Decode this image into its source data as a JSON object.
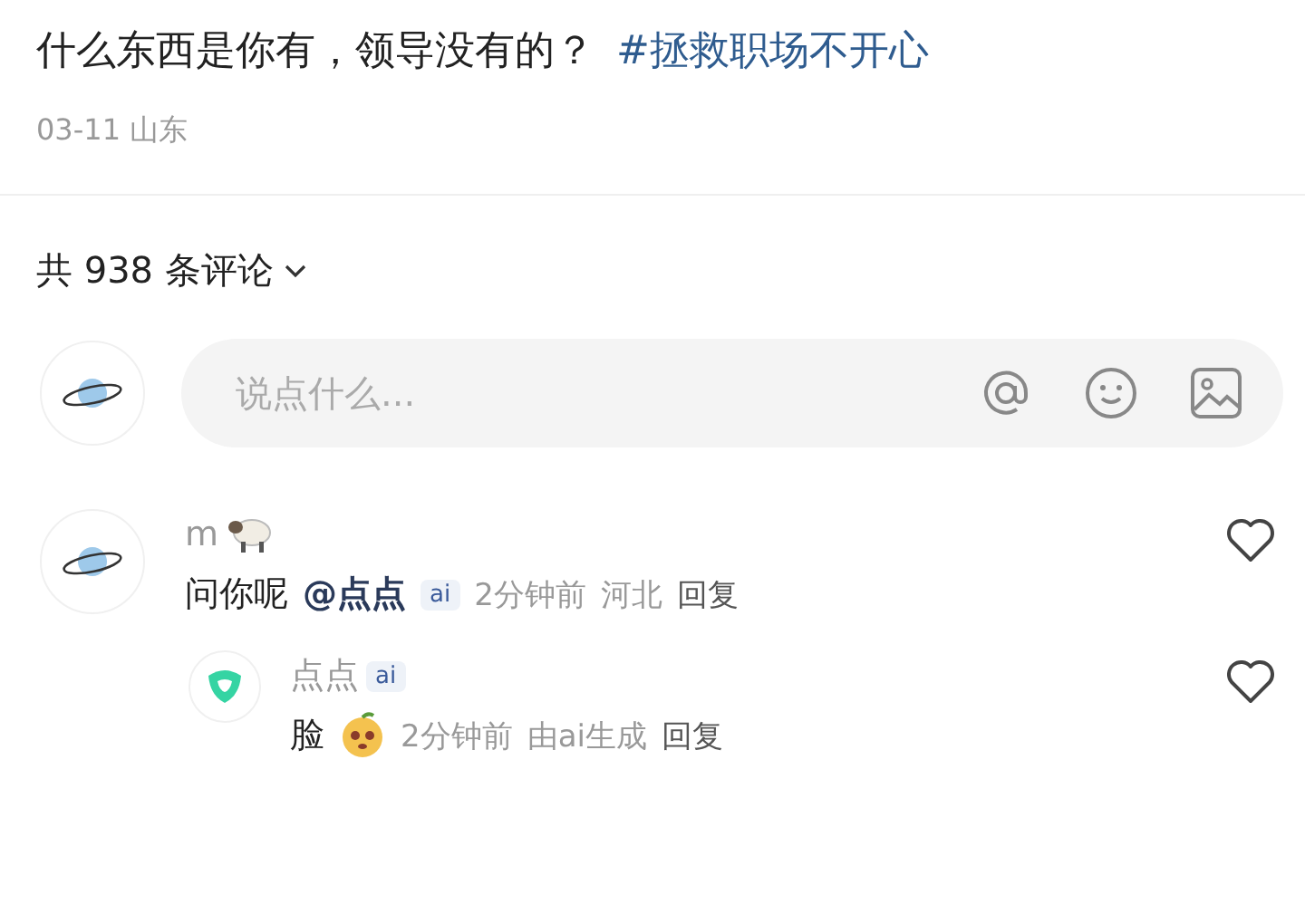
{
  "post": {
    "title": "什么东西是你有，领导没有的？",
    "hashtag": "#拯救职场不开心",
    "meta": "03-11 山东"
  },
  "comments_header": {
    "label": "共 938 条评论"
  },
  "composer": {
    "placeholder": "说点什么..."
  },
  "comments": [
    {
      "author": "m",
      "text": "问你呢",
      "mention": "@点点",
      "badge": "ai",
      "time": "2分钟前",
      "location": "河北",
      "reply": "回复",
      "liked": false,
      "replies": [
        {
          "author": "点点",
          "badge": "ai",
          "text": "脸",
          "time": "2分钟前",
          "source": "由ai生成",
          "reply": "回复",
          "liked": false
        }
      ]
    }
  ]
}
